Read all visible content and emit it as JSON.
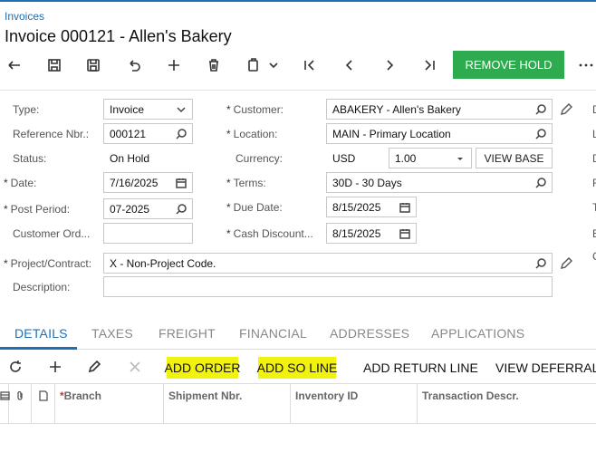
{
  "breadcrumb": "Invoices",
  "page_title": "Invoice 000121 - Allen's Bakery",
  "toolbar": {
    "remove_hold_label": "REMOVE HOLD",
    "more_label": "⋮"
  },
  "form": {
    "type_label": "Type:",
    "type_value": "Invoice",
    "refnbr_label": "Reference Nbr.:",
    "refnbr_value": "000121",
    "status_label": "Status:",
    "status_value": "On Hold",
    "date_label": "Date:",
    "date_value": "7/16/2025",
    "postperiod_label": "Post Period:",
    "postperiod_value": "07-2025",
    "custorder_label": "Customer Ord...",
    "custorder_value": "",
    "customer_label": "Customer:",
    "customer_value": "ABAKERY - Allen's Bakery",
    "location_label": "Location:",
    "location_value": "MAIN - Primary Location",
    "currency_label": "Currency:",
    "currency_value": "USD",
    "rate_value": "1.00",
    "view_base_label": "VIEW BASE",
    "terms_label": "Terms:",
    "terms_value": "30D - 30 Days",
    "duedate_label": "Due Date:",
    "duedate_value": "8/15/2025",
    "cashdisc_label": "Cash Discount...",
    "cashdisc_value": "8/15/2025",
    "project_label": "Project/Contract:",
    "project_value": "X - Non-Project Code.",
    "description_label": "Description:",
    "description_value": "",
    "edge_letters": [
      "D",
      "L",
      "D",
      "F",
      "T",
      "E",
      "C"
    ]
  },
  "tabs": [
    "DETAILS",
    "TAXES",
    "FREIGHT",
    "FINANCIAL",
    "ADDRESSES",
    "APPLICATIONS"
  ],
  "grid_toolbar": {
    "add_order": "ADD ORDER",
    "add_so_line": "ADD SO LINE",
    "add_return_line": "ADD RETURN LINE",
    "view_deferrals": "VIEW DEFERRALS"
  },
  "grid_columns": [
    "Branch",
    "Shipment Nbr.",
    "Inventory ID",
    "Transaction Descr."
  ],
  "colors": {
    "accent": "#1f6fb2",
    "remove_hold_bg": "#2eaa4f",
    "highlight": "#f2f20f"
  }
}
